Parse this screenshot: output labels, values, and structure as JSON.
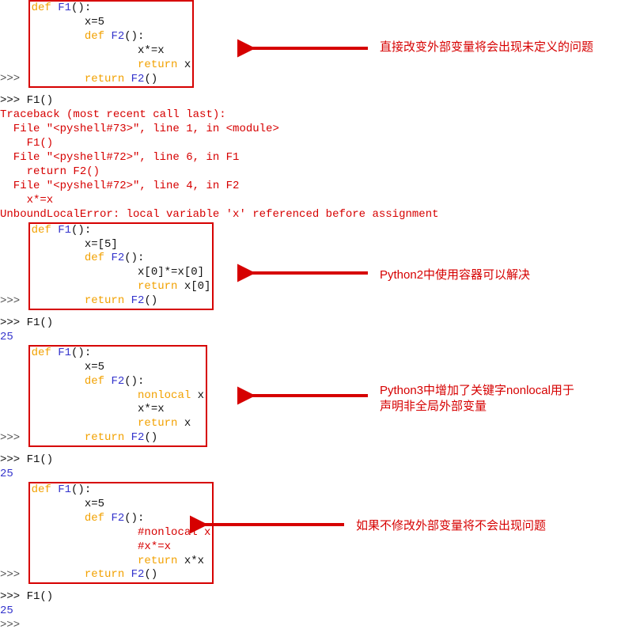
{
  "block1": {
    "l1a": ">>> ",
    "l1b": "def ",
    "l1c": "F1",
    "l1d": "():",
    "l2": "        x=5",
    "l3a": "        ",
    "l3b": "def ",
    "l3c": "F2",
    "l3d": "():",
    "l4": "                x*=x",
    "l5a": "                ",
    "l5b": "return ",
    "l5c": "x",
    "l6a": "        ",
    "l6b": "return ",
    "l6c": "F2",
    "l6d": "()"
  },
  "call1": ">>> F1()",
  "traceback": {
    "t1": "Traceback (most recent call last):",
    "t2": "  File \"<pyshell#73>\", line 1, in <module>",
    "t3": "    F1()",
    "t4": "  File \"<pyshell#72>\", line 6, in F1",
    "t5": "    return F2()",
    "t6": "  File \"<pyshell#72>\", line 4, in F2",
    "t7": "    x*=x",
    "t8": "UnboundLocalError: local variable 'x' referenced before assignment"
  },
  "block2": {
    "l1a": ">>> ",
    "l1b": "def ",
    "l1c": "F1",
    "l1d": "():",
    "l2": "        x=[5]",
    "l3a": "        ",
    "l3b": "def ",
    "l3c": "F2",
    "l3d": "():",
    "l4": "                x[0]*=x[0]",
    "l5a": "                ",
    "l5b": "return ",
    "l5c": "x[0]",
    "l6a": "        ",
    "l6b": "return ",
    "l6c": "F2",
    "l6d": "()"
  },
  "call2": ">>> F1()",
  "out2": "25",
  "block3": {
    "l1a": ">>> ",
    "l1b": "def ",
    "l1c": "F1",
    "l1d": "():",
    "l2": "        x=5",
    "l3a": "        ",
    "l3b": "def ",
    "l3c": "F2",
    "l3d": "():",
    "l4a": "                ",
    "l4b": "nonlocal ",
    "l4c": "x",
    "l5": "                x*=x",
    "l6a": "                ",
    "l6b": "return ",
    "l6c": "x",
    "l7a": "        ",
    "l7b": "return ",
    "l7c": "F2",
    "l7d": "()"
  },
  "call3": ">>> F1()",
  "out3": "25",
  "block4": {
    "l1a": ">>> ",
    "l1b": "def ",
    "l1c": "F1",
    "l1d": "():",
    "l2": "        x=5",
    "l3a": "        ",
    "l3b": "def ",
    "l3c": "F2",
    "l3d": "():",
    "l4a": "                ",
    "l4b": "#nonlocal x",
    "l5a": "                ",
    "l5b": "#x*=x",
    "l6a": "                ",
    "l6b": "return ",
    "l6c": "x*x",
    "l7a": "        ",
    "l7b": "return ",
    "l7c": "F2",
    "l7d": "()"
  },
  "call4": ">>> F1()",
  "out4": "25",
  "tail": ">>> ",
  "annot": {
    "a1": "直接改变外部变量将会出现未定义的问题",
    "a2": "Python2中使用容器可以解决",
    "a3_l1": "Python3中增加了关键字nonlocal用于",
    "a3_l2": "声明非全局外部变量",
    "a4": "如果不修改外部变量将不会出现问题"
  }
}
